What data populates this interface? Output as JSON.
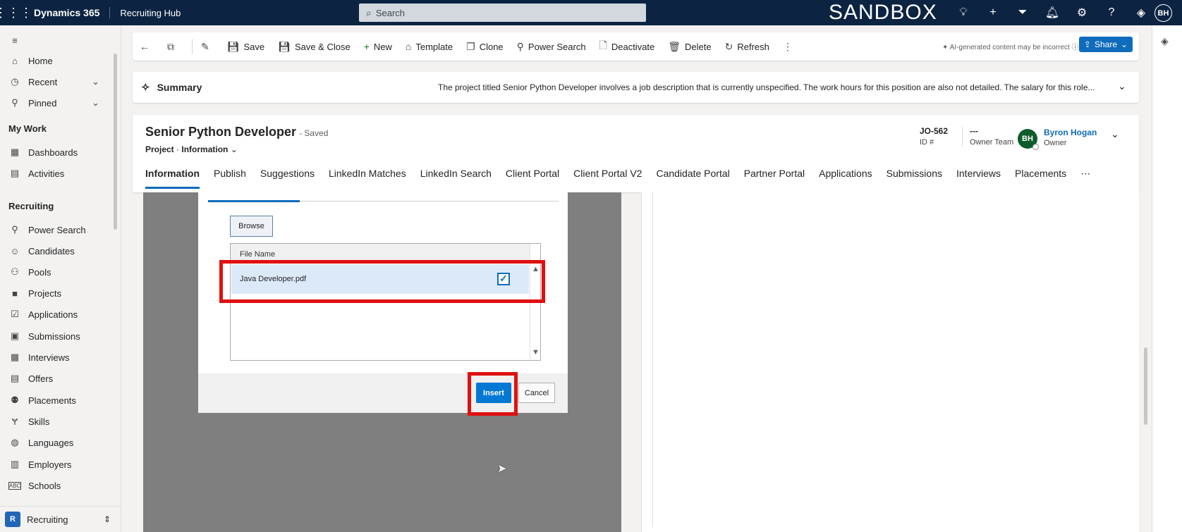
{
  "topbar": {
    "app_name": "Dynamics 365",
    "hub_name": "Recruiting Hub",
    "search_placeholder": "Search",
    "environment_label": "SANDBOX",
    "user_initials": "BH"
  },
  "sidebar": {
    "items_top": [
      {
        "label": "Home",
        "icon": "home-icon"
      },
      {
        "label": "Recent",
        "icon": "clock-icon"
      },
      {
        "label": "Pinned",
        "icon": "pin-icon"
      }
    ],
    "my_work_heading": "My Work",
    "my_work_items": [
      {
        "label": "Dashboards",
        "icon": "dashboard-icon"
      },
      {
        "label": "Activities",
        "icon": "clipboard-icon"
      }
    ],
    "recruiting_heading": "Recruiting",
    "recruiting_items": [
      {
        "label": "Power Search",
        "icon": "search-icon"
      },
      {
        "label": "Candidates",
        "icon": "person-icon"
      },
      {
        "label": "Pools",
        "icon": "people-icon"
      },
      {
        "label": "Projects",
        "icon": "briefcase-icon"
      },
      {
        "label": "Applications",
        "icon": "checkbox-icon"
      },
      {
        "label": "Submissions",
        "icon": "contact-card-icon"
      },
      {
        "label": "Interviews",
        "icon": "calendar-icon"
      },
      {
        "label": "Offers",
        "icon": "document-icon"
      },
      {
        "label": "Placements",
        "icon": "people-team-icon"
      },
      {
        "label": "Skills",
        "icon": "tools-icon"
      },
      {
        "label": "Languages",
        "icon": "globe-icon"
      },
      {
        "label": "Employers",
        "icon": "building-icon"
      },
      {
        "label": "Schools",
        "icon": "abc-icon"
      }
    ],
    "area_badge": "R",
    "area_label": "Recruiting"
  },
  "commandbar": {
    "items": [
      "Save",
      "Save & Close",
      "New",
      "Template",
      "Clone",
      "Power Search",
      "Deactivate",
      "Delete",
      "Refresh"
    ],
    "ai_note": "AI-generated content may be incorrect",
    "share_label": "Share"
  },
  "summary": {
    "label": "Summary",
    "text": "The project titled Senior Python Developer involves a job description that is currently unspecified. The work hours for this position are also not detailed. The salary for this role..."
  },
  "record": {
    "title": "Senior Python Developer",
    "saved_status": "- Saved",
    "entity": "Project",
    "form": "Information",
    "id_value": "JO-562",
    "id_label": "ID #",
    "owner_team_value": "---",
    "owner_team_label": "Owner Team",
    "owner_initials": "BH",
    "owner_name": "Byron Hogan",
    "owner_label": "Owner"
  },
  "tabs": [
    "Information",
    "Publish",
    "Suggestions",
    "LinkedIn Matches",
    "LinkedIn Search",
    "Client Portal",
    "Client Portal V2",
    "Candidate Portal",
    "Partner Portal",
    "Applications",
    "Submissions",
    "Interviews",
    "Placements"
  ],
  "dialog": {
    "browse_label": "Browse",
    "file_column_header": "File Name",
    "files": [
      {
        "name": "Java Developer.pdf",
        "checked": true
      }
    ],
    "insert_label": "Insert",
    "cancel_label": "Cancel"
  },
  "colors": {
    "topbar_bg": "#0c2442",
    "accent": "#0f6cbd",
    "highlight": "#e01010",
    "overlay": "#7f7f7f"
  }
}
